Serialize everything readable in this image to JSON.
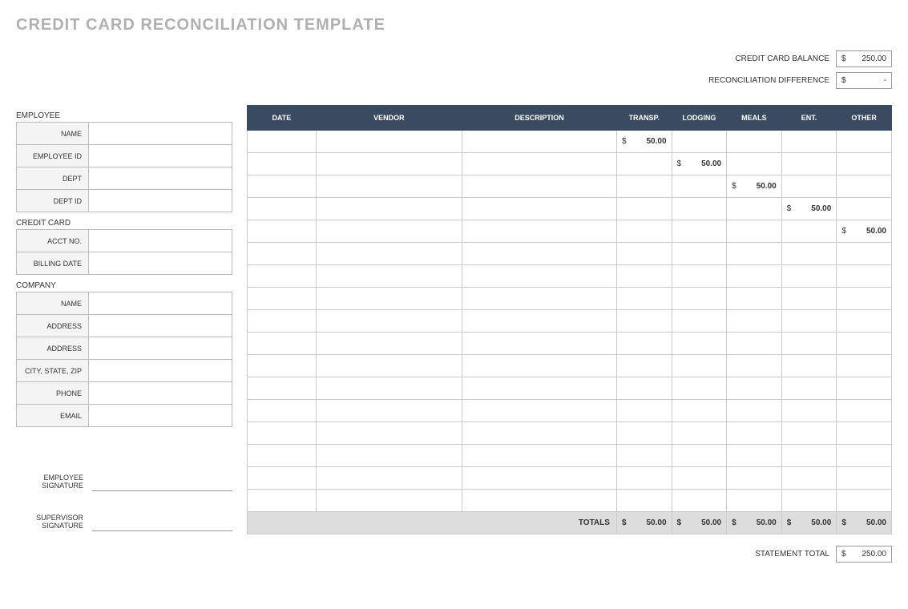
{
  "title": "CREDIT CARD RECONCILIATION TEMPLATE",
  "summary": {
    "balance_label": "CREDIT CARD BALANCE",
    "balance_currency": "$",
    "balance_value": "250.00",
    "diff_label": "RECONCILIATION DIFFERENCE",
    "diff_currency": "$",
    "diff_value": "-"
  },
  "employee": {
    "section": "EMPLOYEE",
    "fields": {
      "name": "NAME",
      "employee_id": "EMPLOYEE ID",
      "dept": "DEPT",
      "dept_id": "DEPT ID"
    }
  },
  "credit_card": {
    "section": "CREDIT CARD",
    "fields": {
      "acct_no": "ACCT NO.",
      "billing_date": "BILLING DATE"
    }
  },
  "company": {
    "section": "COMPANY",
    "fields": {
      "name": "NAME",
      "address1": "ADDRESS",
      "address2": "ADDRESS",
      "csz": "CITY, STATE, ZIP",
      "phone": "PHONE",
      "email": "EMAIL"
    }
  },
  "signatures": {
    "employee": "EMPLOYEE SIGNATURE",
    "supervisor": "SUPERVISOR SIGNATURE"
  },
  "table": {
    "headers": {
      "date": "DATE",
      "vendor": "VENDOR",
      "description": "DESCRIPTION",
      "transp": "TRANSP.",
      "lodging": "LODGING",
      "meals": "MEALS",
      "ent": "ENT.",
      "other": "OTHER"
    },
    "rows": [
      {
        "transp": "50.00"
      },
      {
        "lodging": "50.00"
      },
      {
        "meals": "50.00"
      },
      {
        "ent": "50.00"
      },
      {
        "other": "50.00"
      },
      {},
      {},
      {},
      {},
      {},
      {},
      {},
      {},
      {},
      {},
      {},
      {}
    ],
    "totals_label": "TOTALS",
    "totals": {
      "transp": "50.00",
      "lodging": "50.00",
      "meals": "50.00",
      "ent": "50.00",
      "other": "50.00"
    }
  },
  "statement": {
    "label": "STATEMENT TOTAL",
    "currency": "$",
    "value": "250.00"
  }
}
